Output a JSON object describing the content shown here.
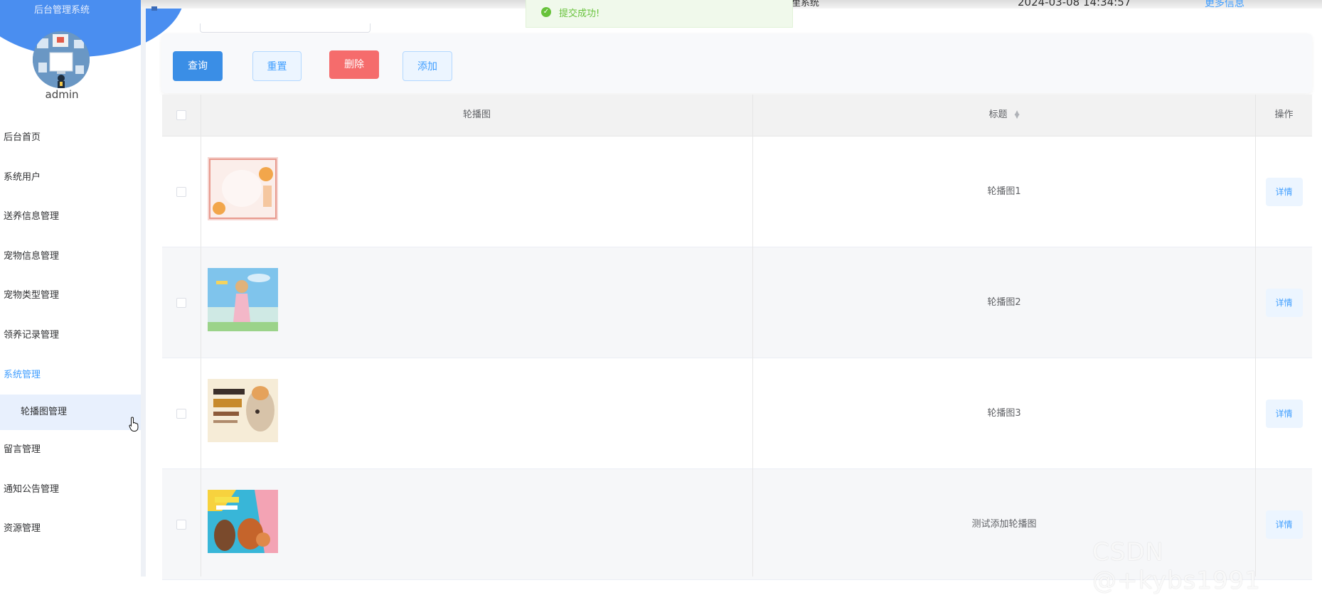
{
  "sidebar": {
    "brand": "后台管理系统",
    "username": "admin",
    "menu": [
      {
        "label": "后台首页"
      },
      {
        "label": "系统用户"
      },
      {
        "label": "送养信息管理"
      },
      {
        "label": "宠物信息管理"
      },
      {
        "label": "宠物类型管理"
      },
      {
        "label": "领养记录管理"
      },
      {
        "label": "系统管理"
      }
    ],
    "submenu_active": "轮播图管理",
    "menu_after": [
      {
        "label": "留言管理"
      },
      {
        "label": "通知公告管理"
      },
      {
        "label": "资源管理"
      }
    ]
  },
  "header": {
    "system_title_partial": "里系统",
    "datetime": "2024-03-08 14:34:57",
    "more_link": "更多信息"
  },
  "toast": {
    "text": "提交成功!",
    "icon": "check-circle-icon",
    "color": "#67c23a"
  },
  "toolbar": {
    "query_label": "查询",
    "reset_label": "重置",
    "delete_label": "删除",
    "add_label": "添加"
  },
  "table": {
    "columns": {
      "image": "轮播图",
      "title": "标题",
      "op": "操作"
    },
    "rows": [
      {
        "title": "轮播图1",
        "image_icon": "pink-cat-banner-thumbnail",
        "detail": "详情"
      },
      {
        "title": "轮播图2",
        "image_icon": "girl-dog-beach-thumbnail",
        "detail": "详情"
      },
      {
        "title": "轮播图3",
        "image_icon": "dog-poster-thumbnail",
        "detail": "详情"
      },
      {
        "title": "测试添加轮播图",
        "image_icon": "pets-promo-thumbnail",
        "detail": "详情"
      }
    ]
  },
  "watermark": "CSDN @+kybs1991",
  "colors": {
    "primary": "#409eff",
    "sidebar_header": "#4a8ef0",
    "danger": "#f56c6c",
    "success": "#67c23a"
  }
}
